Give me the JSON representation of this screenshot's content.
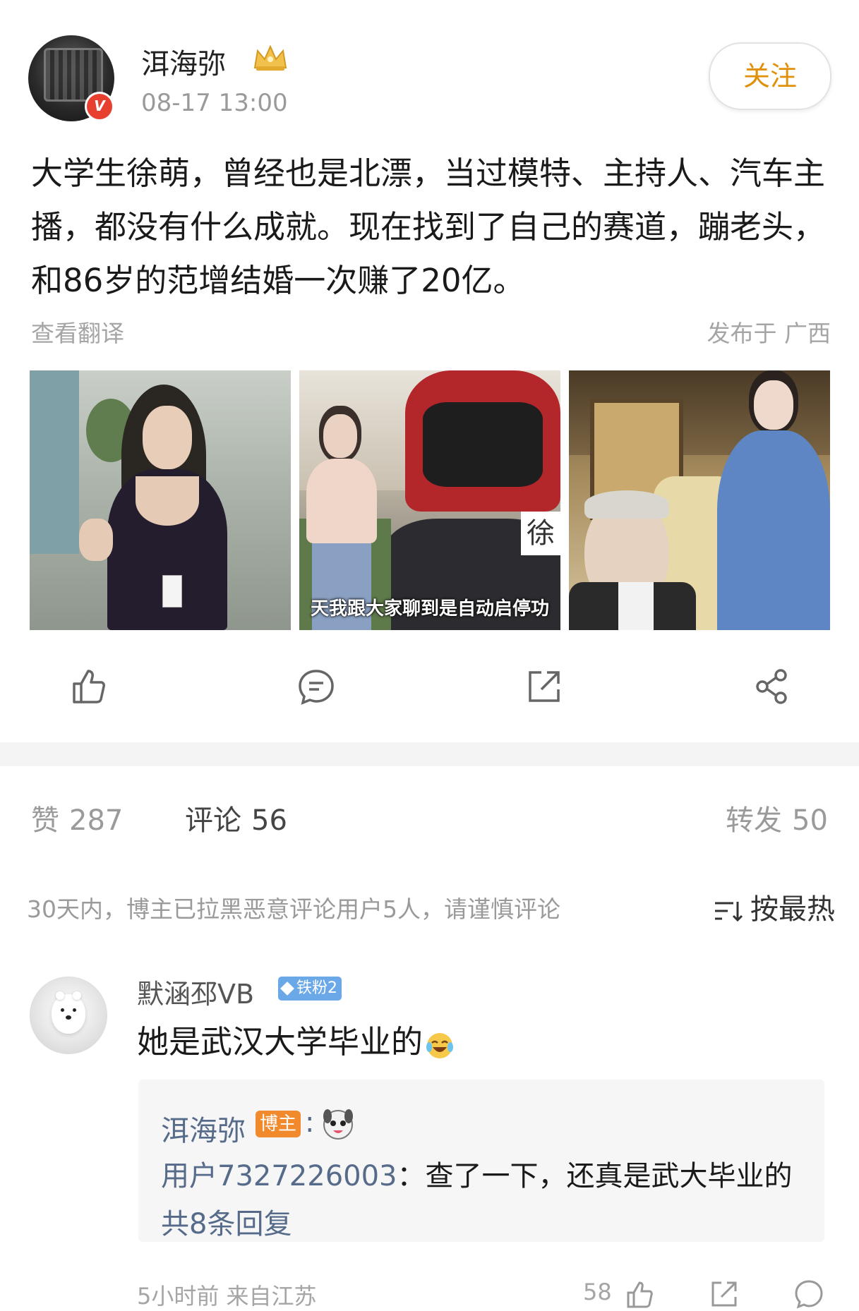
{
  "post": {
    "author": "洱海弥",
    "timestamp": "08-17 13:00",
    "follow_label": "关注",
    "verified_badge": "V",
    "text": "大学生徐萌，曾经也是北漂，当过模特、主持人、汽车主播，都没有什么成就。现在找到了自己的赛道，蹦老头，和86岁的范增结婚一次赚了20亿。",
    "translate_label": "查看翻译",
    "location": "发布于 广西",
    "images": [
      {
        "caption": ""
      },
      {
        "caption": "天我跟大家聊到是自动启停功",
        "tag": "徐"
      },
      {
        "caption": ""
      }
    ]
  },
  "actions": [
    "like-icon",
    "comment-icon",
    "repost-icon",
    "share-icon"
  ],
  "stats": {
    "likes_label": "赞",
    "likes": "287",
    "comments_label": "评论",
    "comments": "56",
    "reposts_label": "转发",
    "reposts": "50"
  },
  "notice": "30天内，博主已拉黑恶意评论用户5人，请谨慎评论",
  "sort_label": "按最热",
  "comment": {
    "author": "默涵邳VB",
    "fan_badge": "铁粉2",
    "text": "她是武汉大学毕业的",
    "reply": {
      "author": "洱海弥",
      "host_badge": "博主",
      "colon": ":",
      "user": "用户7327226003",
      "text": "：查了一下，还真是武大毕业的",
      "count": "共8条回复"
    },
    "meta": "5小时前  来自江苏",
    "likes": "58"
  },
  "colors": {
    "follow": "#e0900a",
    "host_badge": "#f08a2c",
    "fan_badge": "#6aa8e8",
    "verified": "#e8402f",
    "link": "#566b8a"
  }
}
